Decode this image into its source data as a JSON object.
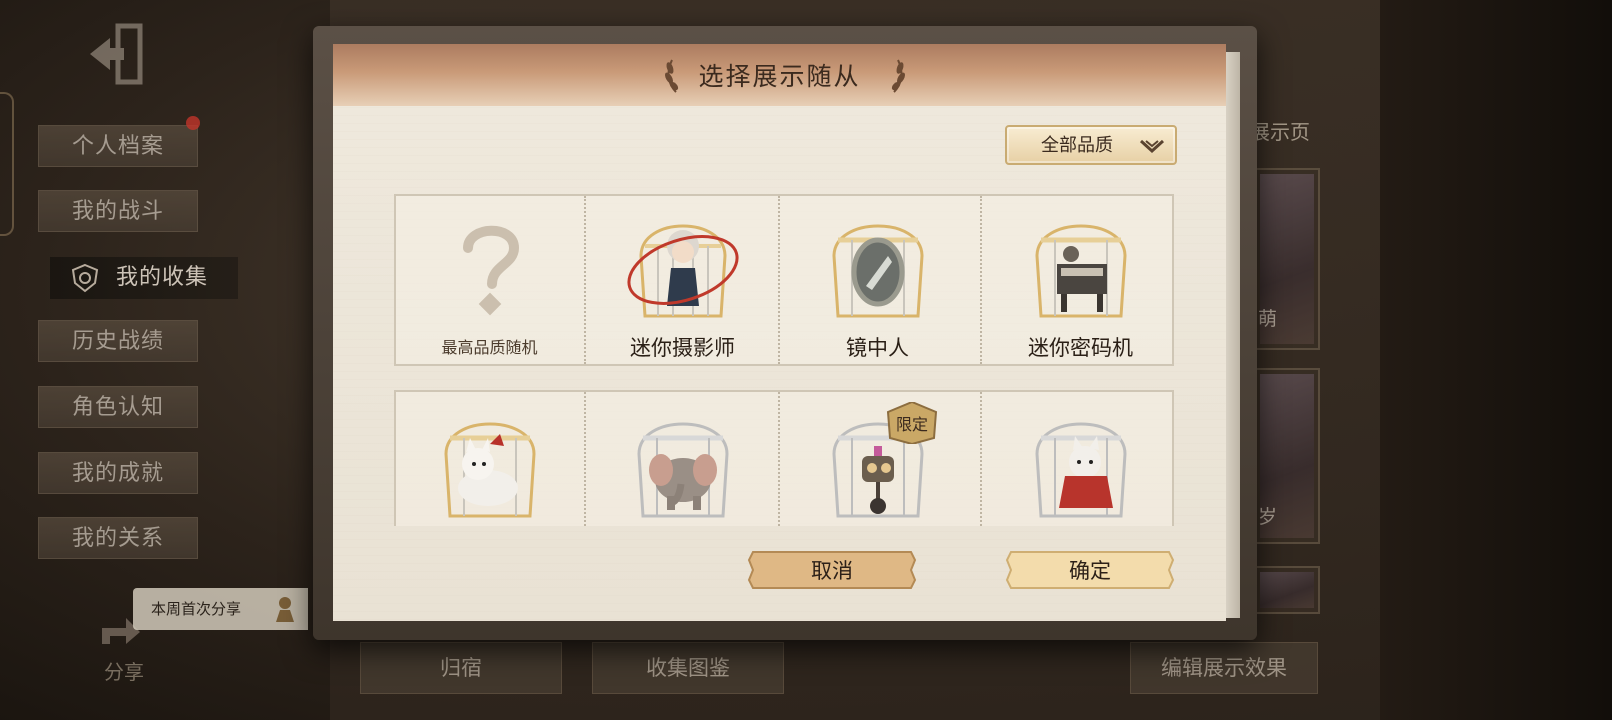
{
  "background": {
    "sidebar": {
      "items": [
        {
          "label": "个人档案"
        },
        {
          "label": "我的战斗"
        },
        {
          "label": "我的收集"
        },
        {
          "label": "历史战绩"
        },
        {
          "label": "角色认知"
        },
        {
          "label": "我的成就"
        },
        {
          "label": "我的关系"
        }
      ]
    },
    "share_tip": "本周首次分享",
    "share_label": "分享",
    "bottom_tabs": [
      "归宿",
      "收集图鉴",
      "编辑展示效果"
    ],
    "right_panel": {
      "title_fragment": "展示页",
      "card_labels": [
        "萌",
        "岁"
      ]
    }
  },
  "modal": {
    "title": "选择展示随从",
    "quality_filter": "全部品质",
    "companions_row1": [
      {
        "name": "最高品质随机",
        "icon": "question-mark-icon"
      },
      {
        "name": "迷你摄影师",
        "icon": "photographer-doll"
      },
      {
        "name": "镜中人",
        "icon": "mirror"
      },
      {
        "name": "迷你密码机",
        "icon": "cipher-machine"
      }
    ],
    "companions_row2": [
      {
        "name": "",
        "icon": "white-fox"
      },
      {
        "name": "",
        "icon": "elephant"
      },
      {
        "name": "",
        "icon": "robot",
        "badge": "限定"
      },
      {
        "name": "",
        "icon": "red-cat"
      }
    ],
    "cancel_label": "取消",
    "confirm_label": "确定"
  },
  "colors": {
    "header": "#c99a78",
    "paper": "#ece6d9",
    "gold": "#d9b46a",
    "red_mark": "#c0392b"
  }
}
